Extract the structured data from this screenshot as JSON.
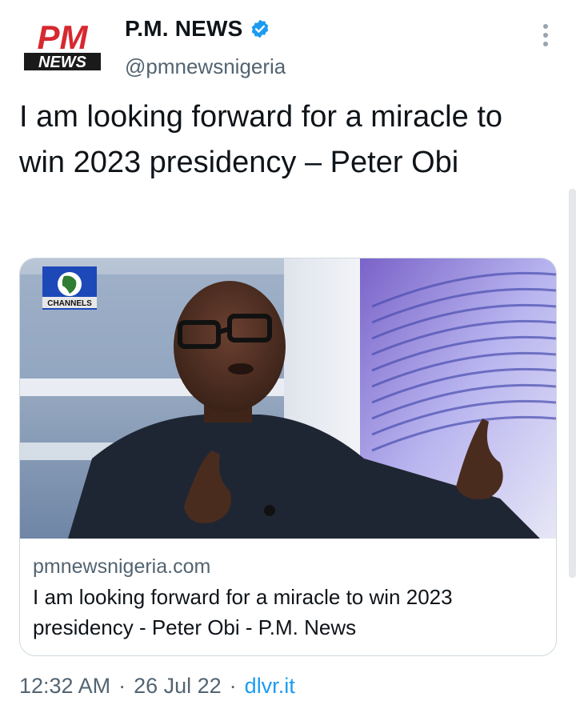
{
  "account": {
    "display_name": "P.M. NEWS",
    "handle": "@pmnewsnigeria",
    "verified": true,
    "logo": {
      "top_text": "PM",
      "bottom_text": "NEWS",
      "icon": "pm-news-logo"
    }
  },
  "tweet": {
    "text": "I am looking forward for a miracle to win 2023 presidency – Peter Obi"
  },
  "card": {
    "image_badge": "CHANNELS",
    "domain": "pmnewsnigeria.com",
    "title": "I am looking forward for a miracle to win 2023 presidency - Peter Obi - P.M. News"
  },
  "footer": {
    "time": "12:32 AM",
    "date": "26 Jul 22",
    "separator": "·",
    "source": "dlvr.it"
  },
  "colors": {
    "text_primary": "#0f1419",
    "text_secondary": "#536471",
    "link": "#1d9bf0",
    "verified_badge": "#1d9bf0",
    "logo_red": "#d7282f"
  }
}
